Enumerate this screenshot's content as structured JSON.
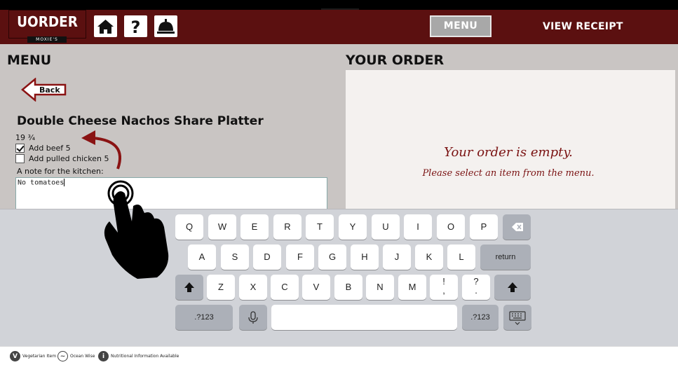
{
  "header": {
    "logo_title": "UORDER",
    "logo_sub": "MOXIE'S",
    "icons": [
      "home-icon",
      "help-icon",
      "service-bell-icon"
    ],
    "menu_label": "MENU",
    "receipt_label": "VIEW RECEIPT",
    "brand_color": "#5b1010"
  },
  "menu": {
    "title": "MENU",
    "back_label": "Back",
    "item_name": "Double Cheese Nachos Share Platter",
    "item_price": "19 ¾",
    "options": [
      {
        "label": "Add beef 5",
        "checked": true
      },
      {
        "label": "Add pulled chicken 5",
        "checked": false
      }
    ],
    "note_label": "A note for the kitchen:",
    "note_value": "No tomatoes"
  },
  "order": {
    "title": "YOUR ORDER",
    "empty_title": "Your order is empty.",
    "empty_sub": "Please select an item from the menu."
  },
  "keyboard": {
    "row1": [
      "Q",
      "W",
      "E",
      "R",
      "T",
      "Y",
      "U",
      "I",
      "O",
      "P"
    ],
    "row2": [
      "A",
      "S",
      "D",
      "F",
      "G",
      "H",
      "J",
      "K",
      "L"
    ],
    "return_label": "return",
    "row3": [
      "Z",
      "X",
      "C",
      "V",
      "B",
      "N",
      "M"
    ],
    "punct1": "!",
    "punct1b": ",",
    "punct2": "?",
    "punct2b": ".",
    "numbers_label": ".?123",
    "icons": [
      "backspace-icon",
      "shift-icon",
      "microphone-icon",
      "keyboard-hide-icon"
    ]
  },
  "footer": {
    "legend": [
      {
        "icon": "vegetarian-icon",
        "glyph": "V",
        "label": "Vegetarian Item"
      },
      {
        "icon": "ocean-wise-icon",
        "glyph": "~",
        "label": "Ocean Wise"
      },
      {
        "icon": "info-icon",
        "glyph": "i",
        "label": "Nutritional Information Available"
      }
    ]
  }
}
